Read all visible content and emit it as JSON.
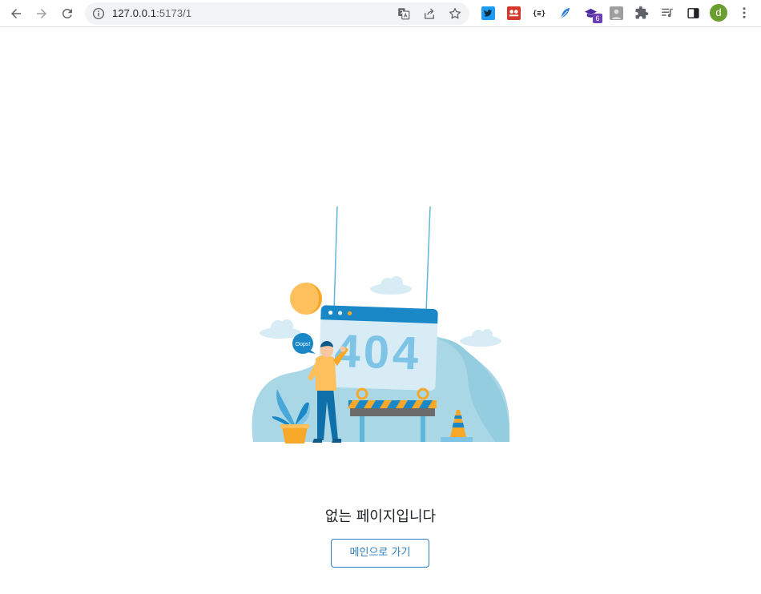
{
  "browser": {
    "url_host": "127.0.0.1",
    "url_port_path": ":5173/1",
    "profile_initial": "d",
    "extension_badge": "6",
    "icons": [
      "back-icon",
      "forward-icon",
      "reload-icon",
      "site-info-icon",
      "translate-icon",
      "share-icon",
      "bookmark-star-icon",
      "twitter-extension-icon",
      "extension-2-icon",
      "json-formatter-icon",
      "feather-extension-icon",
      "graduation-extension-icon",
      "profile-extension-icon",
      "extensions-puzzle-icon",
      "reading-list-icon",
      "side-panel-icon",
      "avatar",
      "menu-icon"
    ]
  },
  "page": {
    "illustration": {
      "screen_text": "404",
      "speech_bubble": "Oops!"
    },
    "message": "없는 페이지입니다",
    "home_button_label": "메인으로 가기"
  },
  "colors": {
    "accent": "#2d7ec1",
    "illustration_blue": "#1a87c7",
    "illustration_light_blue": "#a9d7e6",
    "illustration_orange": "#f7a829"
  }
}
